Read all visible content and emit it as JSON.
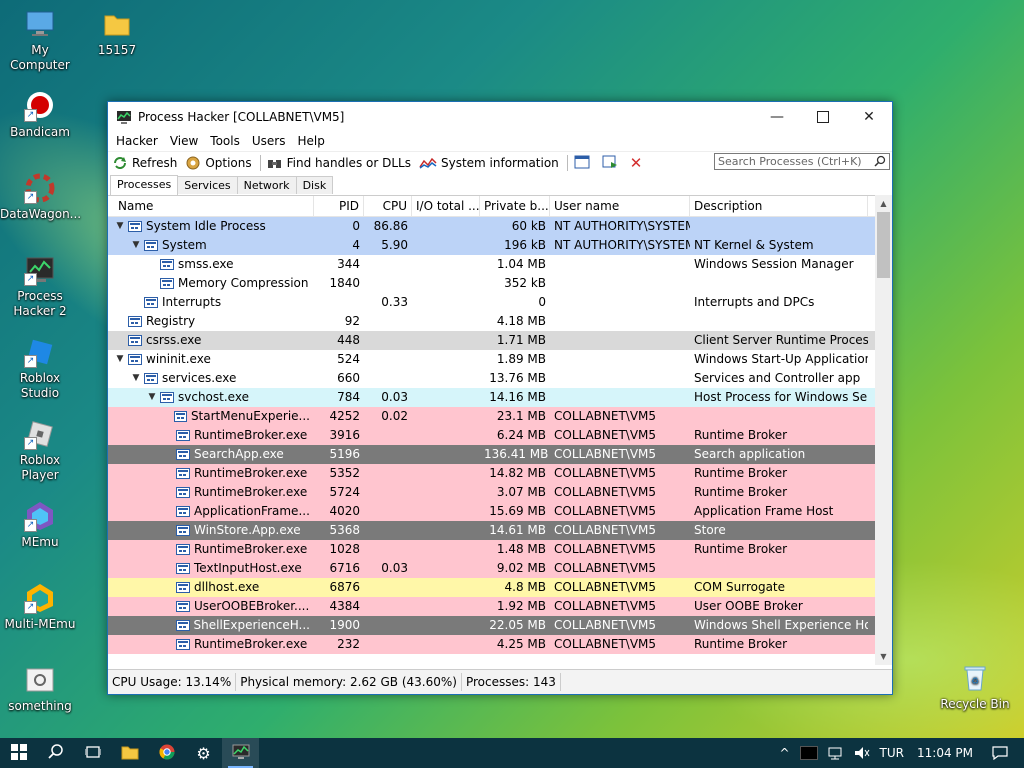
{
  "desktop": {
    "icons": [
      {
        "label": "My Computer"
      },
      {
        "label": "15157"
      },
      {
        "label": "Bandicam"
      },
      {
        "label": "DataWagon..."
      },
      {
        "label": "Process Hacker 2"
      },
      {
        "label": "Roblox Studio"
      },
      {
        "label": "Roblox Player"
      },
      {
        "label": "MEmu"
      },
      {
        "label": "Multi-MEmu"
      },
      {
        "label": "something"
      },
      {
        "label": "Recycle Bin"
      }
    ]
  },
  "window": {
    "title": "Process Hacker [COLLABNET\\VM5]",
    "menu": [
      "Hacker",
      "View",
      "Tools",
      "Users",
      "Help"
    ],
    "toolbar": {
      "refresh": "Refresh",
      "options": "Options",
      "find_handles": "Find handles or DLLs",
      "system_info": "System information"
    },
    "search_placeholder": "Search Processes (Ctrl+K)",
    "tabs": [
      "Processes",
      "Services",
      "Network",
      "Disk"
    ],
    "columns": {
      "name": "Name",
      "pid": "PID",
      "cpu": "CPU",
      "io": "I/O total ...",
      "private": "Private b...",
      "user": "User name",
      "desc": "Description"
    },
    "rows": [
      {
        "name": "System Idle Process",
        "pid": "0",
        "cpu": "86.86",
        "io": "",
        "priv": "60 kB",
        "user": "NT AUTHORITY\\SYSTEM",
        "desc": "",
        "depth": 0,
        "exp": "v",
        "bg": "#bcd3f7"
      },
      {
        "name": "System",
        "pid": "4",
        "cpu": "5.90",
        "io": "",
        "priv": "196 kB",
        "user": "NT AUTHORITY\\SYSTEM",
        "desc": "NT Kernel & System",
        "depth": 1,
        "exp": "v",
        "bg": "#bcd3f7"
      },
      {
        "name": "smss.exe",
        "pid": "344",
        "cpu": "",
        "io": "",
        "priv": "1.04 MB",
        "user": "",
        "desc": "Windows Session Manager",
        "depth": 2,
        "exp": "",
        "bg": "#ffffff"
      },
      {
        "name": "Memory Compression",
        "pid": "1840",
        "cpu": "",
        "io": "",
        "priv": "352 kB",
        "user": "",
        "desc": "",
        "depth": 2,
        "exp": "",
        "bg": "#ffffff"
      },
      {
        "name": "Interrupts",
        "pid": "",
        "cpu": "0.33",
        "io": "",
        "priv": "0",
        "user": "",
        "desc": "Interrupts and DPCs",
        "depth": 1,
        "exp": "",
        "bg": "#ffffff"
      },
      {
        "name": "Registry",
        "pid": "92",
        "cpu": "",
        "io": "",
        "priv": "4.18 MB",
        "user": "",
        "desc": "",
        "depth": 0,
        "exp": "",
        "bg": "#ffffff"
      },
      {
        "name": "csrss.exe",
        "pid": "448",
        "cpu": "",
        "io": "",
        "priv": "1.71 MB",
        "user": "",
        "desc": "Client Server Runtime Process",
        "depth": 0,
        "exp": "",
        "bg": "#d9d9d9"
      },
      {
        "name": "wininit.exe",
        "pid": "524",
        "cpu": "",
        "io": "",
        "priv": "1.89 MB",
        "user": "",
        "desc": "Windows Start-Up Application",
        "depth": 0,
        "exp": "v",
        "bg": "#ffffff"
      },
      {
        "name": "services.exe",
        "pid": "660",
        "cpu": "",
        "io": "",
        "priv": "13.76 MB",
        "user": "",
        "desc": "Services and Controller app",
        "depth": 1,
        "exp": "v",
        "bg": "#ffffff"
      },
      {
        "name": "svchost.exe",
        "pid": "784",
        "cpu": "0.03",
        "io": "",
        "priv": "14.16 MB",
        "user": "",
        "desc": "Host Process for Windows Ser...",
        "depth": 2,
        "exp": "v",
        "bg": "#d6f5fa"
      },
      {
        "name": "StartMenuExperie...",
        "pid": "4252",
        "cpu": "0.02",
        "io": "",
        "priv": "23.1 MB",
        "user": "COLLABNET\\VM5",
        "desc": "",
        "depth": 3,
        "exp": "",
        "bg": "#ffc5cf"
      },
      {
        "name": "RuntimeBroker.exe",
        "pid": "3916",
        "cpu": "",
        "io": "",
        "priv": "6.24 MB",
        "user": "COLLABNET\\VM5",
        "desc": "Runtime Broker",
        "depth": 3,
        "exp": "",
        "bg": "#ffc5cf"
      },
      {
        "name": "SearchApp.exe",
        "pid": "5196",
        "cpu": "",
        "io": "",
        "priv": "136.41 MB",
        "user": "COLLABNET\\VM5",
        "desc": "Search application",
        "depth": 3,
        "exp": "",
        "bg": "#7a7a7a"
      },
      {
        "name": "RuntimeBroker.exe",
        "pid": "5352",
        "cpu": "",
        "io": "",
        "priv": "14.82 MB",
        "user": "COLLABNET\\VM5",
        "desc": "Runtime Broker",
        "depth": 3,
        "exp": "",
        "bg": "#ffc5cf"
      },
      {
        "name": "RuntimeBroker.exe",
        "pid": "5724",
        "cpu": "",
        "io": "",
        "priv": "3.07 MB",
        "user": "COLLABNET\\VM5",
        "desc": "Runtime Broker",
        "depth": 3,
        "exp": "",
        "bg": "#ffc5cf"
      },
      {
        "name": "ApplicationFrame...",
        "pid": "4020",
        "cpu": "",
        "io": "",
        "priv": "15.69 MB",
        "user": "COLLABNET\\VM5",
        "desc": "Application Frame Host",
        "depth": 3,
        "exp": "",
        "bg": "#ffc5cf"
      },
      {
        "name": "WinStore.App.exe",
        "pid": "5368",
        "cpu": "",
        "io": "",
        "priv": "14.61 MB",
        "user": "COLLABNET\\VM5",
        "desc": "Store",
        "depth": 3,
        "exp": "",
        "bg": "#7a7a7a"
      },
      {
        "name": "RuntimeBroker.exe",
        "pid": "1028",
        "cpu": "",
        "io": "",
        "priv": "1.48 MB",
        "user": "COLLABNET\\VM5",
        "desc": "Runtime Broker",
        "depth": 3,
        "exp": "",
        "bg": "#ffc5cf"
      },
      {
        "name": "TextInputHost.exe",
        "pid": "6716",
        "cpu": "0.03",
        "io": "",
        "priv": "9.02 MB",
        "user": "COLLABNET\\VM5",
        "desc": "",
        "depth": 3,
        "exp": "",
        "bg": "#ffc5cf"
      },
      {
        "name": "dllhost.exe",
        "pid": "6876",
        "cpu": "",
        "io": "",
        "priv": "4.8 MB",
        "user": "COLLABNET\\VM5",
        "desc": "COM Surrogate",
        "depth": 3,
        "exp": "",
        "bg": "#fff7a8"
      },
      {
        "name": "UserOOBEBroker....",
        "pid": "4384",
        "cpu": "",
        "io": "",
        "priv": "1.92 MB",
        "user": "COLLABNET\\VM5",
        "desc": "User OOBE Broker",
        "depth": 3,
        "exp": "",
        "bg": "#ffc5cf"
      },
      {
        "name": "ShellExperienceH...",
        "pid": "1900",
        "cpu": "",
        "io": "",
        "priv": "22.05 MB",
        "user": "COLLABNET\\VM5",
        "desc": "Windows Shell Experience Host",
        "depth": 3,
        "exp": "",
        "bg": "#7a7a7a"
      },
      {
        "name": "RuntimeBroker.exe",
        "pid": "232",
        "cpu": "",
        "io": "",
        "priv": "4.25 MB",
        "user": "COLLABNET\\VM5",
        "desc": "Runtime Broker",
        "depth": 3,
        "exp": "",
        "bg": "#ffc5cf"
      }
    ],
    "status": {
      "cpu": "CPU Usage: 13.14%",
      "mem": "Physical memory: 2.62 GB (43.60%)",
      "procs": "Processes: 143"
    }
  },
  "taskbar": {
    "language": "TUR",
    "time": "11:04 PM"
  }
}
